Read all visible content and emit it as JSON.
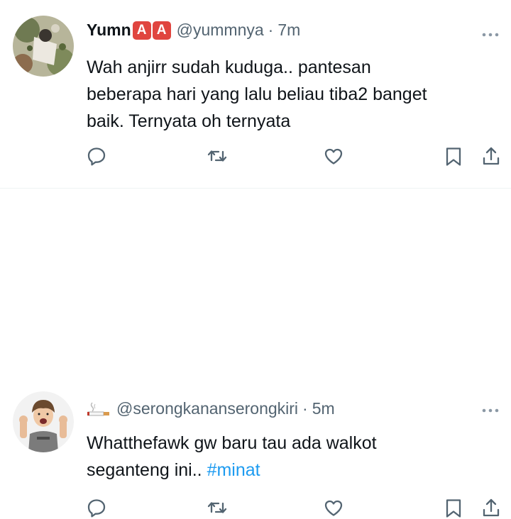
{
  "tweets": [
    {
      "name": "Yumn",
      "badges": [
        "A",
        "A"
      ],
      "handle": "@yummnya",
      "separator": "·",
      "time": "7m",
      "text_lines": [
        "Wah anjirr sudah kuduga.. pantesan",
        "beberapa hari yang lalu beliau tiba2 banget",
        "baik. Ternyata oh ternyata"
      ]
    },
    {
      "handle": "@serongkananserongkiri",
      "separator": "·",
      "time": "5m",
      "text_line1": "Whatthefawk gw baru tau ada walkot",
      "text_line2": "seganteng ini.. ",
      "hashtag": "#minat"
    }
  ],
  "icons": [
    "reply-icon",
    "retweet-icon",
    "like-icon",
    "bookmark-icon",
    "share-icon",
    "more-icon",
    "cigarette-icon"
  ],
  "colors": {
    "secondary_text": "#536471",
    "hashtag": "#1d9bf0",
    "badge": "#e0453f"
  }
}
